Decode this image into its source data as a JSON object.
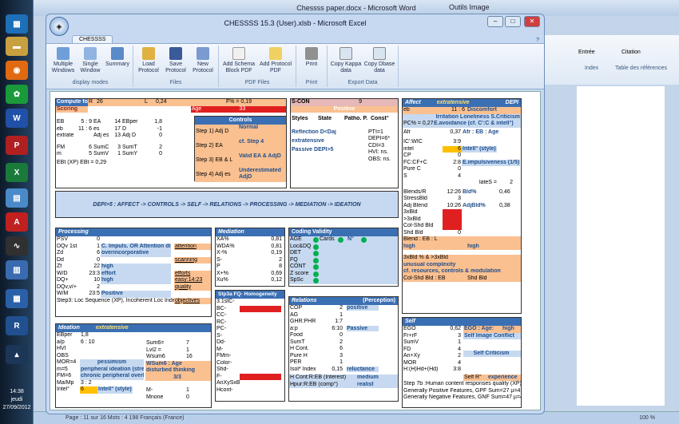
{
  "taskbar": {
    "clock_time": "14:38",
    "clock_day": "jeudi",
    "clock_date": "27/09/2012"
  },
  "word": {
    "title": "Chessss paper.docx - Microsoft Word",
    "tools": "Outils Image",
    "ribbon": {
      "entree": "Entrée",
      "citation": "Citation",
      "index": "Index",
      "tables": "Table des références"
    },
    "status": "Page : 11 sur 16   Mots : 4 198   Français (France)",
    "zoom": "100 %"
  },
  "excel": {
    "title": "CHESSSS 15.3 (User).xlsb - Microsoft Excel",
    "tab": "CHESSSS",
    "groups": [
      {
        "label": "display modes",
        "buttons": [
          "Multiple Windows",
          "Single Window",
          "Summary"
        ]
      },
      {
        "label": "Files",
        "buttons": [
          "Load Protocol",
          "Save Protocol",
          "New Protocol"
        ]
      },
      {
        "label": "PDF Files",
        "buttons": [
          "Add Schema Block PDF",
          "Add Protocol PDF"
        ]
      },
      {
        "label": "Print",
        "buttons": [
          "Print"
        ]
      },
      {
        "label": "Export Data",
        "buttons": [
          "Copy Kappa data",
          "Copy Dbase data"
        ]
      }
    ]
  },
  "sheet": {
    "compute": {
      "title": "Compute for",
      "R": "R",
      "Rv": "26",
      "L": "L",
      "Lv": "0,24",
      "F": "F% = 0,19",
      "scoring": "Scoring",
      "age": "Age",
      "agev": "33"
    },
    "eb": [
      [
        "EB",
        "5 : 9",
        "EA",
        "14",
        "EBper",
        "1,8"
      ],
      [
        "eb",
        "11 : 6",
        "es",
        "17",
        "D",
        "-1"
      ],
      [
        "extratensive",
        "",
        "Adj es",
        "13",
        "Adj D",
        "0"
      ]
    ],
    "fm": [
      [
        "FM",
        "6",
        "SumC'",
        "3",
        "SumT",
        "2"
      ],
      [
        "m",
        "5",
        "SumV",
        "1",
        "SumY",
        "0"
      ]
    ],
    "ebt": "EBt (XP)    EBt = 0,29",
    "controls": {
      "title": "Controls",
      "rows": [
        [
          "Step 1) Adj D",
          "Normal"
        ],
        [
          "Step 2) EA",
          "cf. Step 4"
        ],
        [
          "Step 3) EB & L",
          "Valid EA & AdjD"
        ],
        [
          "Step 4) Adj es",
          "Underestimated AdjD"
        ]
      ]
    },
    "scon": {
      "title": "S-CON",
      "value": "9",
      "status": "Positive",
      "cols": [
        "Styles",
        "State",
        "Patho. P.",
        "Const°"
      ],
      "lines": [
        "Reflection   D<Daj",
        "extratensive",
        "Passive   DEPI>5"
      ],
      "indices": [
        "PTI=1",
        "DEPI=6*",
        "CDI=3",
        "HVI: ns.",
        "OBS: ns."
      ]
    },
    "depi_chain": "DEPI>5 : AFFECT -> CONTROLS -> SELF -> RELATIONS -> PROCESSING -> MEDIATION -> IDEATION",
    "affect": {
      "title": "Affect",
      "style": "extratensive",
      "depi": "DEPI",
      "eb": "eb",
      "ebv": "11 : 6",
      "discomfort": "Discomfort",
      "irritation": "Irritation Loneliness S.Criticism",
      "pc": "PC% = 0,27",
      "avoid": "E.avoidance (cf. C':C & intell°)",
      "afr": "Afr",
      "afrv": "0,37",
      "afr_age": "Afr : EB : Age",
      "rows": [
        [
          "IC':WIC",
          "3:9"
        ],
        [
          "intel",
          "6"
        ],
        [
          "CP",
          "0"
        ],
        [
          "FC:CF+C",
          "2:8"
        ],
        [
          "Pure C",
          "0"
        ],
        [
          "S",
          "4"
        ]
      ],
      "intel_style": "Intell° (style)",
      "impuls": "E.impulsiveness (1/5)",
      "lateS": "lateS =",
      "lateSv": "2",
      "blends": [
        [
          "Blends/R",
          "12:26"
        ],
        [
          "StressBld",
          "3"
        ],
        [
          "Adj Blend",
          "10:26"
        ],
        [
          "3xBld",
          ""
        ],
        [
          ">3xBld",
          ""
        ],
        [
          "Col-Shd Bld",
          ""
        ],
        [
          "Shd Bld",
          "0"
        ]
      ],
      "bld_pct": "Bld%",
      "bldv": "0,46",
      "adjbld": "AdjBld%",
      "adjbldv": "0,38",
      "blend_eb": "Blend : EB : L",
      "high1": "high",
      "high2": "high",
      "bld3": "3xBld % & >3xBld",
      "unusual": "unusual complexity",
      "cf_res": "cf. resources, controls & modulation",
      "colshd": "Col-Shd Bld : EB",
      "shdbld": "Shd Bld"
    },
    "processing": {
      "title": "Processing",
      "rows": [
        [
          "PSV",
          "0",
          ""
        ],
        [
          "DQv 1st",
          "1",
          "C. Impuls. OR Attention diff."
        ],
        [
          "Zd",
          "6",
          "overincorporative"
        ],
        [
          "Dd",
          "0",
          ""
        ],
        [
          "Zf",
          "22",
          "high"
        ],
        [
          "W/D",
          "23:3",
          "effort"
        ],
        [
          "DQ+",
          "10",
          "high"
        ],
        [
          "DQv,v/+",
          "2",
          ""
        ],
        [
          "W/M",
          "23:5",
          "Positive"
        ]
      ],
      "side": [
        "attention",
        "scanning",
        "efforts",
        "easy:14:23",
        "quality",
        "objectives"
      ],
      "step3": "Step3: Loc Sequence (XP), Incoherent Loc Index, ILI = 0"
    },
    "mediation": {
      "title": "Mediation",
      "rows": [
        [
          "XA%",
          "0,81"
        ],
        [
          "WDA%",
          "0,81"
        ],
        [
          "X-%",
          "0,19"
        ],
        [
          "S-",
          "2"
        ],
        [
          "P",
          "8"
        ],
        [
          "X+%",
          "0,69"
        ],
        [
          "Xu%",
          "0,12"
        ]
      ]
    },
    "coding": {
      "title": "Coding Validity",
      "items": [
        "AGE",
        "Loc&DQ",
        "DET",
        "FQ",
        "CONT",
        "Z score",
        "SpSc"
      ],
      "cards": "Cards",
      "n": "N°"
    },
    "stp3a": {
      "title": "Stp3a FQ- Homogeneity (Sl",
      "rows": [
        "3.1stC-",
        "BC-",
        "CC-",
        "RC-",
        "PC-",
        "S-",
        "Dd-",
        "M-",
        "FMm-",
        "Color-",
        "Shd-",
        "F-",
        "AnXySxBl-",
        "Hcont-"
      ]
    },
    "relations": {
      "title": "Relations",
      "perception": "(Perception)",
      "rows": [
        [
          "COP",
          "2"
        ],
        [
          "AG",
          "1"
        ],
        [
          "GHR:PHR",
          "1:7"
        ],
        [
          "a:p",
          "6:10"
        ],
        [
          "Food",
          "0"
        ],
        [
          "SumT",
          "2"
        ],
        [
          "H Cont.",
          "6"
        ],
        [
          "Pure H",
          "3"
        ],
        [
          "PER",
          "1"
        ],
        [
          "Isol* Index",
          "0,15"
        ]
      ],
      "positive": "positive",
      "passive": "Passive",
      "reluctance": "reluctance",
      "hcont": "H Cont:R:EB (Interest)",
      "medium": "medium",
      "hpur": "Hpur:R:EB (comp°)",
      "realist": "realist"
    },
    "ideation": {
      "title": "Ideation",
      "style": "extratensive",
      "rows": [
        [
          "EBper",
          "1,8"
        ],
        [
          "a/p",
          "6 : 10"
        ],
        [
          "HVI",
          ""
        ],
        [
          "OBS",
          ""
        ],
        [
          "MOR=4",
          "pessimism"
        ],
        [
          "m=5",
          "peripheral ideation (stress)"
        ],
        [
          "FM=6",
          "chronic peripheral overload"
        ],
        [
          "Ma/Mp",
          "3 : 2"
        ],
        [
          "Intel°",
          "6"
        ]
      ],
      "sum6": "Sum6=",
      "sum6v": "7",
      "lvl2": "Lvl2 =",
      "lvl2v": "1",
      "wsum6": "Wsum6",
      "wsum6v": "16",
      "wsum_age": "WSum6 : Age",
      "disturbed": "disturbed thinking",
      "ratio": "3/3",
      "intell_style": "Intell° (style)",
      "mminus": "M-",
      "mminusv": "1",
      "mnone": "Mnone",
      "mnonev": "0"
    },
    "self": {
      "title": "Self",
      "rows": [
        [
          "EGO",
          "0,62"
        ],
        [
          "Fr+rF",
          "3"
        ],
        [
          "SumV",
          "1"
        ],
        [
          "FD",
          "4"
        ],
        [
          "An+Xy",
          "2"
        ],
        [
          "MOR",
          "4"
        ],
        [
          "H:(H)Hd+(Hd)",
          "3:8"
        ]
      ],
      "ego_age": "EGO : Age:",
      "ego_high": "high",
      "self_img": "Self Image Conflict",
      "self_crit": "Self Criticism",
      "selfr": "Self R°",
      "experience": "experience",
      "step7b": "Step 7b :Human content responses quality (XP)",
      "gen_pos": "Generally Positive Features, GPF Sum=27 µ=4,5",
      "gen_neg": "Generally Negative Features, GNF Sum=47 µ=4,5"
    }
  }
}
